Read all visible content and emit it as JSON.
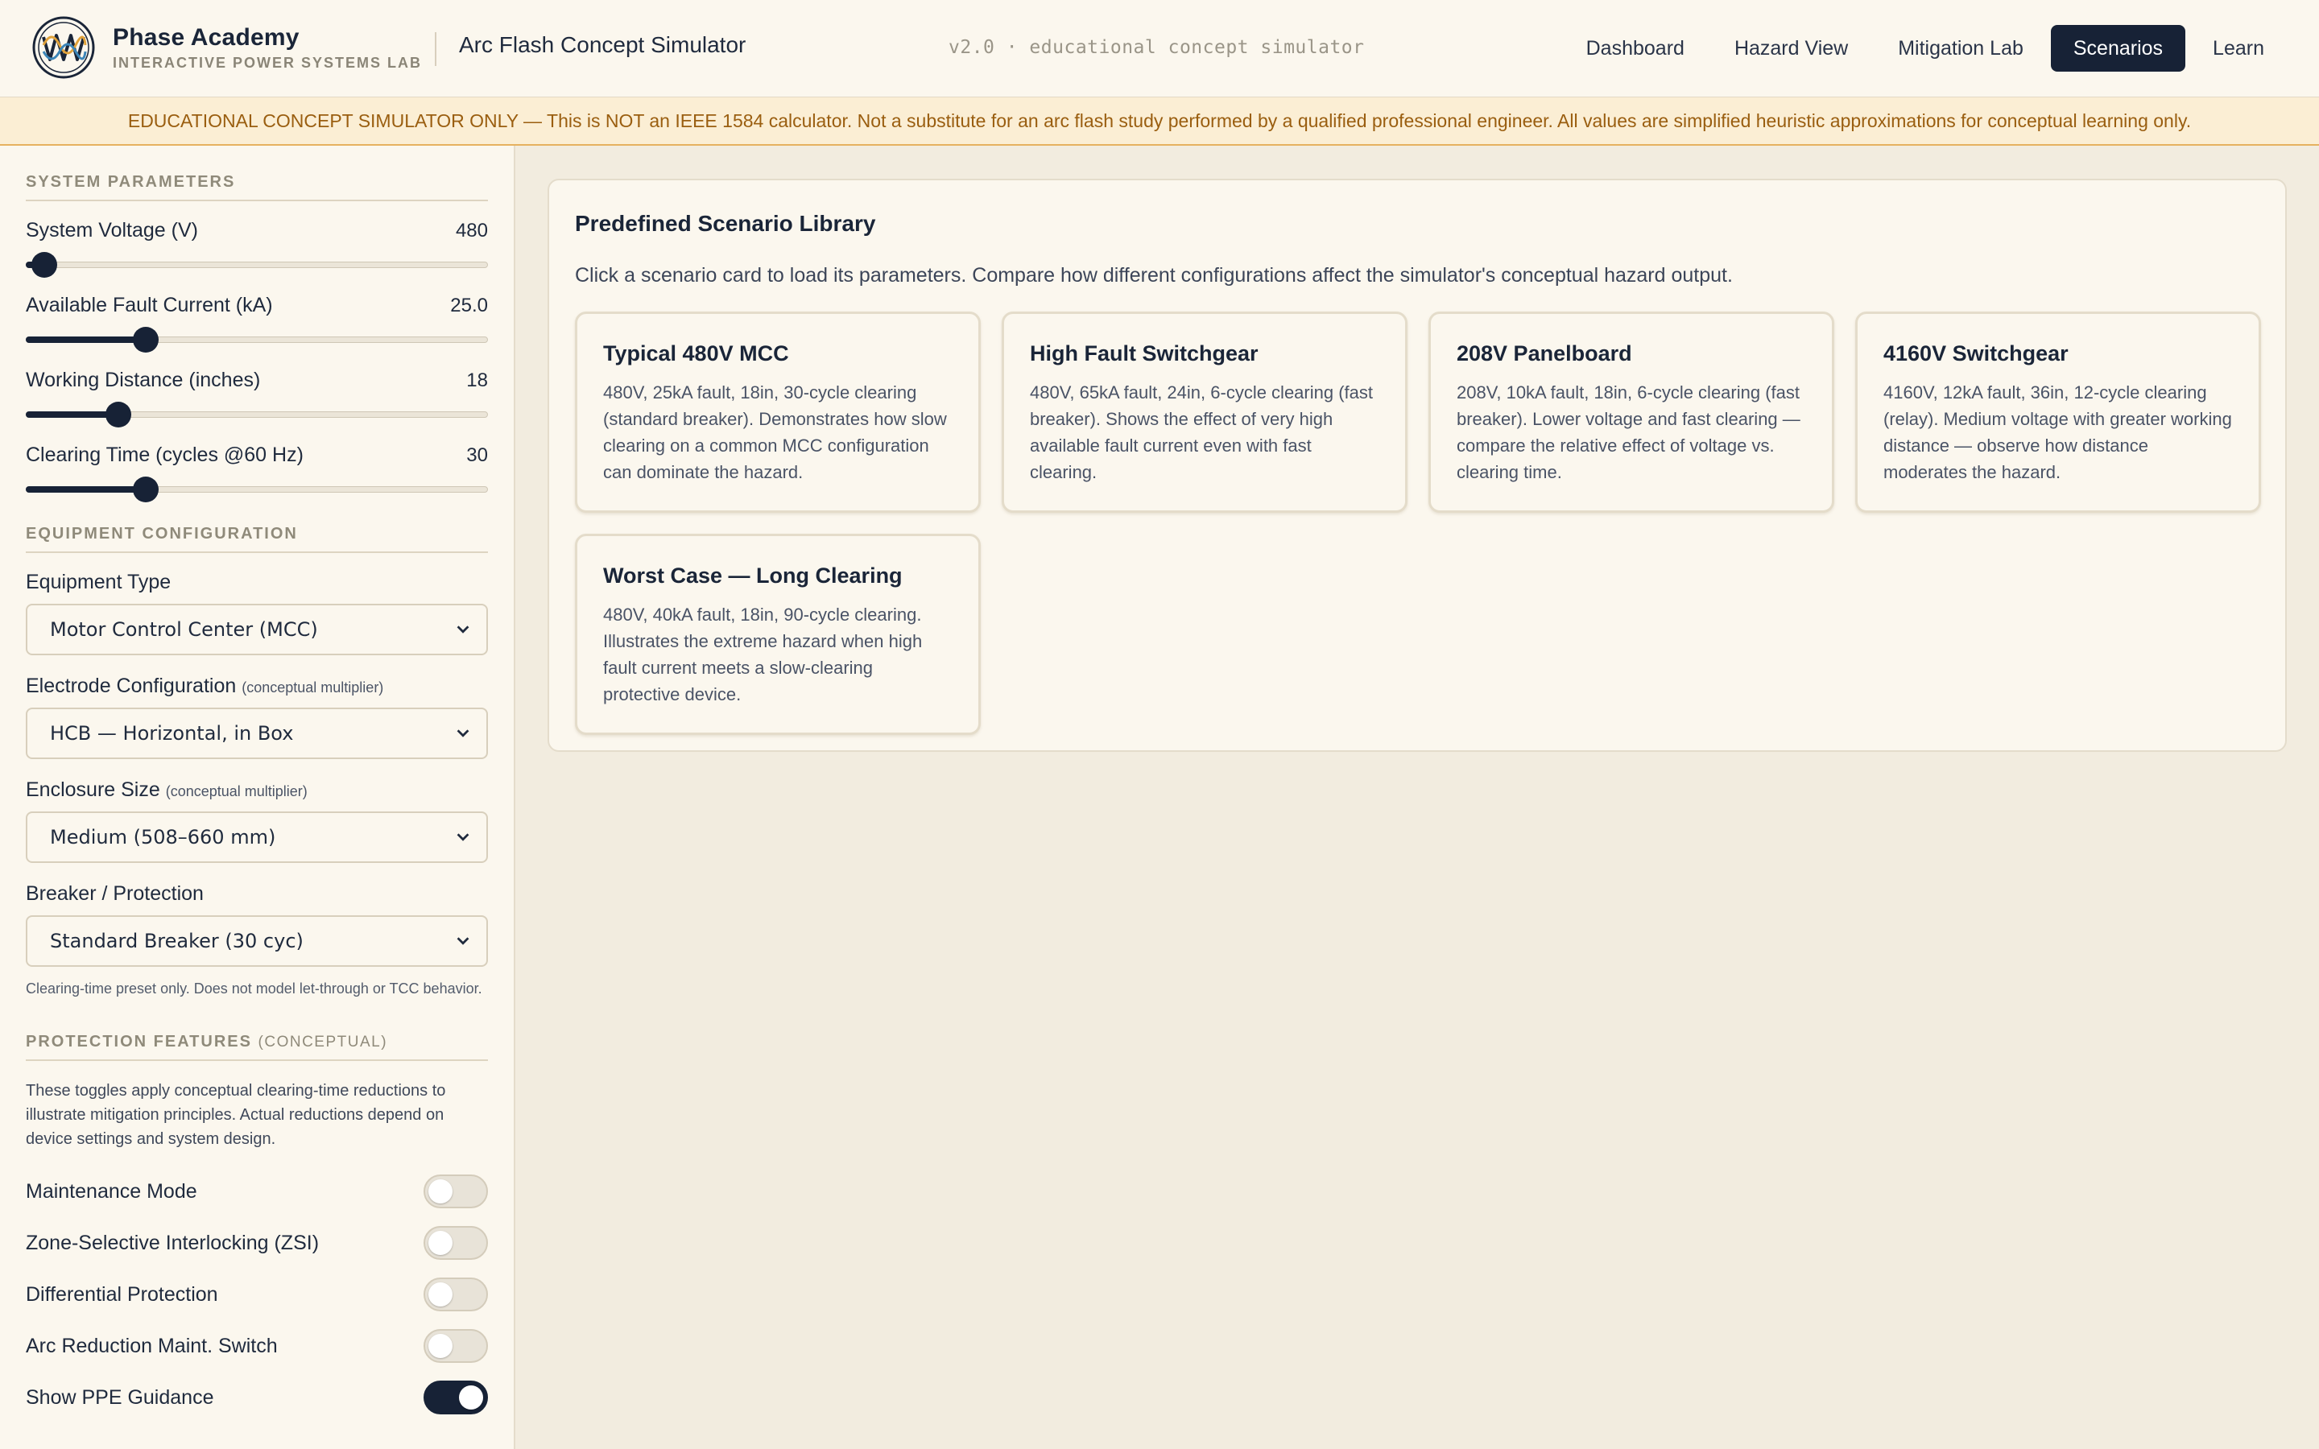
{
  "header": {
    "brand_name": "Phase Academy",
    "brand_sub": "INTERACTIVE POWER SYSTEMS LAB",
    "app_title": "Arc Flash Concept Simulator",
    "version": "v2.0 · educational concept simulator",
    "nav": [
      {
        "label": "Dashboard",
        "active": false
      },
      {
        "label": "Hazard View",
        "active": false
      },
      {
        "label": "Mitigation Lab",
        "active": false
      },
      {
        "label": "Scenarios",
        "active": true
      },
      {
        "label": "Learn",
        "active": false
      }
    ]
  },
  "banner": "EDUCATIONAL CONCEPT SIMULATOR ONLY — This is NOT an IEEE 1584 calculator. Not a substitute for an arc flash study performed by a qualified professional engineer. All values are simplified heuristic approximations for conceptual learning only.",
  "sidebar": {
    "system_params_title": "SYSTEM PARAMETERS",
    "params": [
      {
        "label": "System Voltage (V)",
        "value": "480",
        "fraction": 0.04
      },
      {
        "label": "Available Fault Current (kA)",
        "value": "25.0",
        "fraction": 0.26
      },
      {
        "label": "Working Distance (inches)",
        "value": "18",
        "fraction": 0.2
      },
      {
        "label": "Clearing Time (cycles @60 Hz)",
        "value": "30",
        "fraction": 0.26
      }
    ],
    "equipment_title": "EQUIPMENT CONFIGURATION",
    "equipment_type_label": "Equipment Type",
    "equipment_type_value": "Motor Control Center (MCC)",
    "electrode_label": "Electrode Configuration",
    "electrode_note": "(conceptual multiplier)",
    "electrode_value": "HCB — Horizontal, in Box",
    "enclosure_label": "Enclosure Size",
    "enclosure_note": "(conceptual multiplier)",
    "enclosure_value": "Medium (508–660 mm)",
    "breaker_label": "Breaker / Protection",
    "breaker_value": "Standard Breaker (30 cyc)",
    "breaker_hint": "Clearing-time preset only. Does not model let-through or TCC behavior.",
    "protection_title": "PROTECTION FEATURES",
    "protection_title_sub": "(CONCEPTUAL)",
    "protection_desc": "These toggles apply conceptual clearing-time reductions to illustrate mitigation principles. Actual reductions depend on device settings and system design.",
    "toggles": [
      {
        "label": "Maintenance Mode",
        "on": false
      },
      {
        "label": "Zone-Selective Interlocking (ZSI)",
        "on": false
      },
      {
        "label": "Differential Protection",
        "on": false
      },
      {
        "label": "Arc Reduction Maint. Switch",
        "on": false
      },
      {
        "label": "Show PPE Guidance",
        "on": true
      }
    ]
  },
  "main": {
    "title": "Predefined Scenario Library",
    "description": "Click a scenario card to load its parameters. Compare how different configurations affect the simulator's conceptual hazard output.",
    "scenarios": [
      {
        "title": "Typical 480V MCC",
        "body": "480V, 25kA fault, 18in, 30-cycle clearing (standard breaker). Demonstrates how slow clearing on a common MCC configuration can dominate the hazard."
      },
      {
        "title": "High Fault Switchgear",
        "body": "480V, 65kA fault, 24in, 6-cycle clearing (fast breaker). Shows the effect of very high available fault current even with fast clearing."
      },
      {
        "title": "208V Panelboard",
        "body": "208V, 10kA fault, 18in, 6-cycle clearing (fast breaker). Lower voltage and fast clearing — compare the relative effect of voltage vs. clearing time."
      },
      {
        "title": "4160V Switchgear",
        "body": "4160V, 12kA fault, 36in, 12-cycle clearing (relay). Medium voltage with greater working distance — observe how distance moderates the hazard."
      },
      {
        "title": "Worst Case — Long Clearing",
        "body": "480V, 40kA fault, 18in, 90-cycle clearing. Illustrates the extreme hazard when high fault current meets a slow-clearing protective device."
      }
    ]
  }
}
